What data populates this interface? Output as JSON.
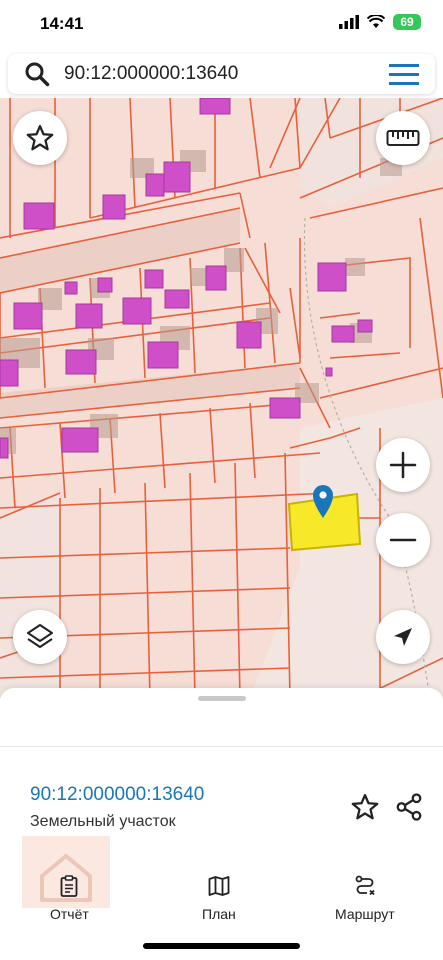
{
  "status": {
    "time": "14:41",
    "battery": "69"
  },
  "search": {
    "query": "90:12:000000:13640"
  },
  "map": {
    "colors": {
      "background": "#f6ddd6",
      "parcel_border": "#e8603c",
      "building": "#cf4fc8",
      "building_shadow": "#b89b90",
      "selected_fill": "#f7e92a",
      "selected_border": "#c9b200",
      "pin": "#1a76b8"
    },
    "controls": [
      "star-icon",
      "ruler-icon",
      "zoom-in-icon",
      "zoom-out-icon",
      "layers-icon",
      "navigation-arrow-icon"
    ]
  },
  "sheet": {
    "parcel_id": "90:12:000000:13640",
    "parcel_type": "Земельный участок"
  },
  "nav": {
    "report": "Отчёт",
    "plan": "План",
    "route": "Маршрут"
  }
}
